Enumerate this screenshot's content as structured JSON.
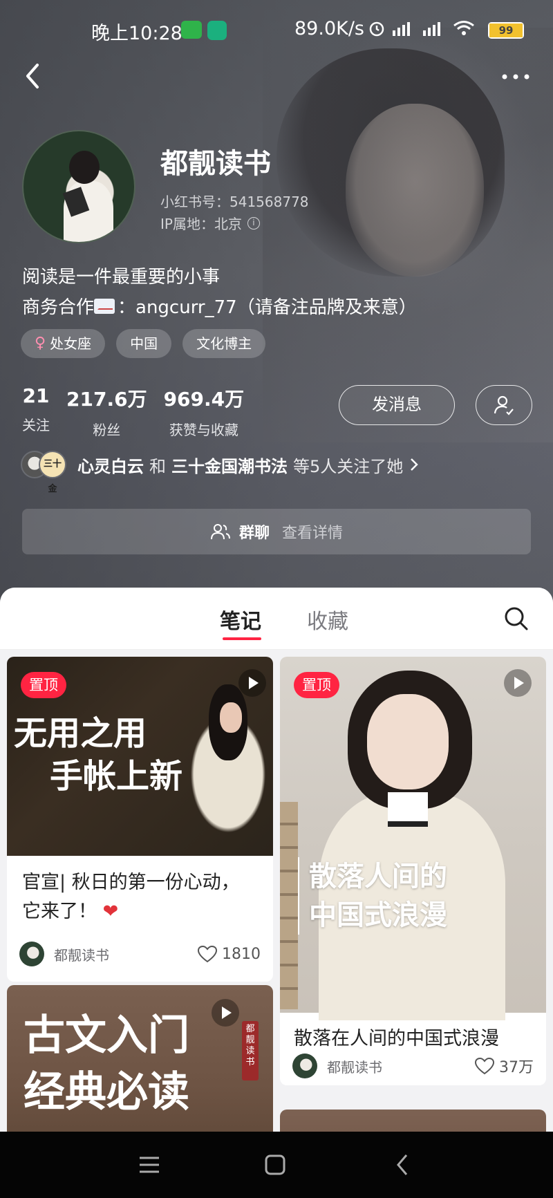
{
  "status_bar": {
    "time": "晚上10:28",
    "speed": "89.0K/s",
    "battery": "99"
  },
  "profile": {
    "name": "都靓读书",
    "red_id": "小红书号：541568778",
    "ip_location": "IP属地：北京",
    "bio_line1": "阅读是一件最重要的小事",
    "bio_line2_prefix": "商务合作",
    "bio_line2_suffix": "：angcurr_77（请备注品牌及来意）",
    "tags": [
      "处女座",
      "中国",
      "文化博主"
    ],
    "stats": [
      {
        "value": "21",
        "label": "关注"
      },
      {
        "value": "217.6万",
        "label": "粉丝"
      },
      {
        "value": "969.4万",
        "label": "获赞与收藏"
      }
    ],
    "message_button": "发消息",
    "mutual": {
      "name1": "心灵白云",
      "conj": "和",
      "name2": "三十金国潮书法",
      "suffix": "等5人关注了她",
      "badge_text": "三十金"
    },
    "group_chat": {
      "label": "群聊",
      "detail": "查看详情"
    }
  },
  "tabs": {
    "notes": "笔记",
    "collections": "收藏"
  },
  "cards": [
    {
      "pin": "置顶",
      "cover_line1": "无用之用",
      "cover_line2": "手帐上新",
      "title": "官宣| 秋日的第一份心动，它来了！",
      "author": "都靓读书",
      "likes": "1810"
    },
    {
      "pin": "置顶",
      "cover_line1": "散落人间的",
      "cover_line2": "中国式浪漫",
      "title": "散落在人间的中国式浪漫",
      "author": "都靓读书",
      "likes": "37万"
    },
    {
      "cover_line1": "古文入门",
      "cover_line2": "经典必读",
      "seal": "都靓读书"
    }
  ],
  "colors": {
    "accent": "#ff2442",
    "header_bg": "#62646a"
  }
}
